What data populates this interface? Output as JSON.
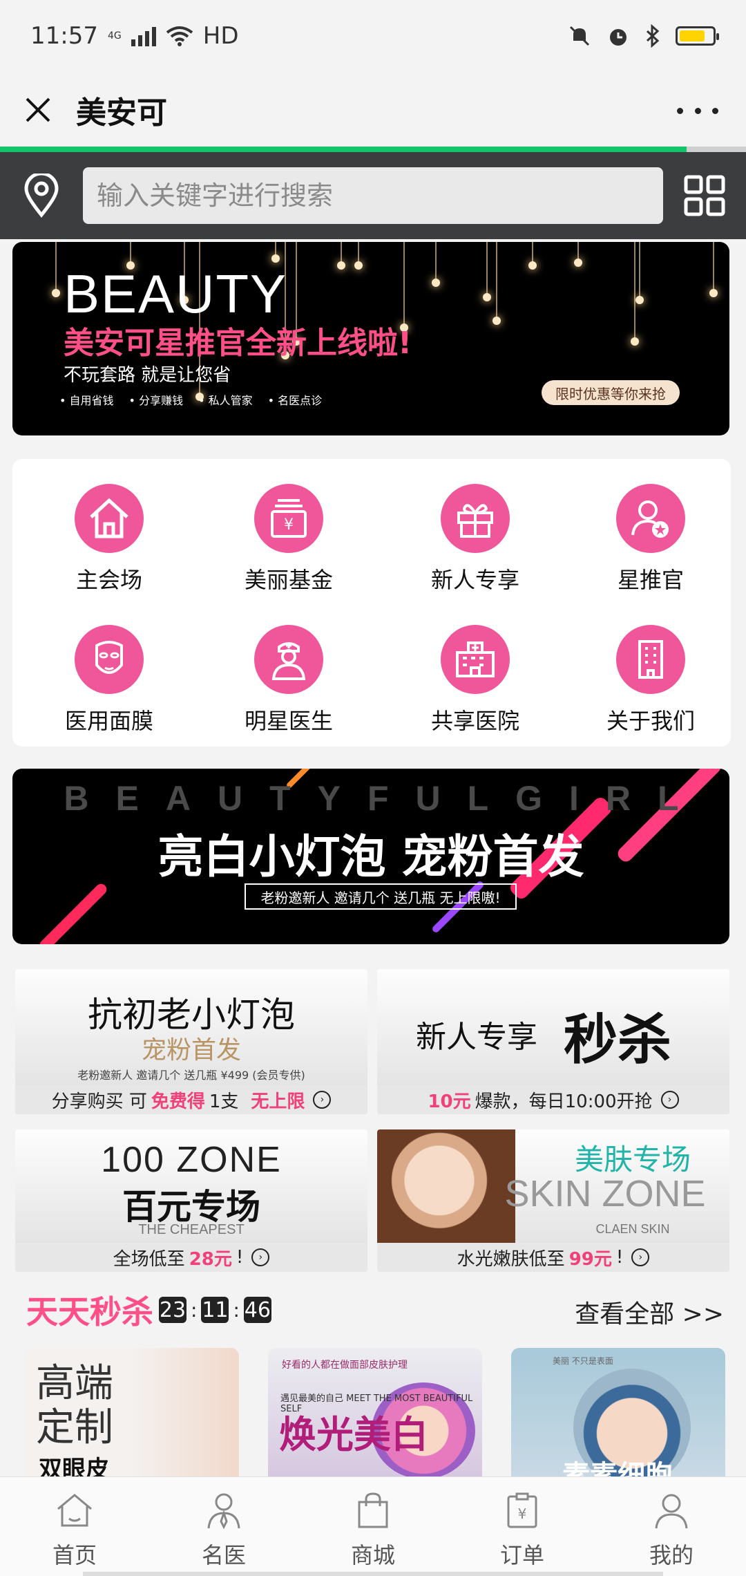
{
  "status_bar": {
    "time": "11:57",
    "network": "4G",
    "hd": "HD"
  },
  "title_bar": {
    "title": "美安可"
  },
  "load_progress": 0.92,
  "search": {
    "placeholder": "输入关键字进行搜索"
  },
  "top_banner": {
    "title": "BEAUTY",
    "subtitle": "美安可星推官全新上线啦!",
    "line3": "不玩套路 就是让您省",
    "tags": [
      "自用省钱",
      "分享赚钱",
      "私人管家",
      "名医点诊"
    ],
    "badge": "限时优惠等你来抢"
  },
  "grid": [
    {
      "label": "主会场",
      "icon": "house-icon"
    },
    {
      "label": "美丽基金",
      "icon": "yuan-box-icon"
    },
    {
      "label": "新人专享",
      "icon": "gift-icon"
    },
    {
      "label": "星推官",
      "icon": "star-user-icon"
    },
    {
      "label": "医用面膜",
      "icon": "face-mask-icon"
    },
    {
      "label": "明星医生",
      "icon": "doctor-icon"
    },
    {
      "label": "共享医院",
      "icon": "hospital-icon"
    },
    {
      "label": "关于我们",
      "icon": "building-icon"
    }
  ],
  "mid_banner": {
    "letters": "BEAUTYFULGIRL",
    "title": "亮白小灯泡 宠粉首发",
    "sub": "老粉邀新人 邀请几个 送几瓶 无上限嗷!"
  },
  "cards": {
    "c1": {
      "t1": "抗初老小灯泡",
      "t2": "宠粉首发",
      "t3": "老粉邀新人 邀请几个 送几瓶 ¥499 (会员专供)",
      "foot_a": "分享购买 可",
      "foot_red": "免费得",
      "foot_b": "1支",
      "foot_red2": "无上限"
    },
    "c2": {
      "t1": "新人专享",
      "t2": "秒杀",
      "foot_red": "10元",
      "foot_b": "爆款，每日10:00开抢"
    },
    "c3": {
      "t1": "100 ZONE",
      "t2": "百元专场",
      "t3": "THE CHEAPEST",
      "foot_a": "全场低至",
      "foot_red": "28元",
      "foot_b": "!"
    },
    "c4": {
      "t1": "美肤专场",
      "t2": "SKIN ZONE",
      "t3": "CLAEN SKIN",
      "foot_a": "水光嫩肤低至",
      "foot_red": "99元",
      "foot_b": "!"
    }
  },
  "flash_sale": {
    "title": "天天秒杀",
    "hours": "23",
    "minutes": "11",
    "seconds": "46",
    "view_all": "查看全部 >>"
  },
  "products": [
    {
      "line1": "高端定制",
      "line2": "双眼皮"
    },
    {
      "line1": "好看的人都在做面部皮肤护理",
      "line2": "遇见最美的自己 MEET THE MOST BEAUTIFUL SELF",
      "line3": "焕光美白"
    },
    {
      "line1": "美丽 不只是表面",
      "line3": "素素细胞"
    }
  ],
  "bottom_nav": [
    {
      "label": "首页",
      "icon": "home-icon"
    },
    {
      "label": "名医",
      "icon": "doctor-user-icon"
    },
    {
      "label": "商城",
      "icon": "shopping-bag-icon"
    },
    {
      "label": "订单",
      "icon": "order-clipboard-icon"
    },
    {
      "label": "我的",
      "icon": "profile-icon"
    }
  ],
  "colors": {
    "accent_pink": "#f0579a",
    "progress_green": "#12c56b",
    "header_dark": "#3c3d3f"
  }
}
